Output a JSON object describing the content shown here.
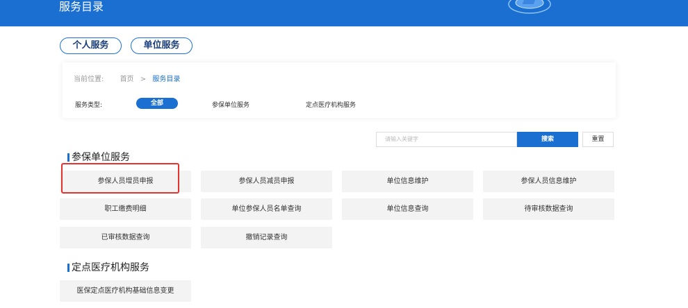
{
  "header": {
    "title": "服务目录"
  },
  "tabs": [
    {
      "label": "个人服务"
    },
    {
      "label": "单位服务"
    }
  ],
  "breadcrumb": {
    "label": "当前位置:",
    "home": "首页",
    "separator": ">",
    "current": "服务目录"
  },
  "filters": {
    "label": "服务类型:",
    "options": [
      "全部",
      "参保单位服务",
      "定点医疗机构服务"
    ],
    "selected": "全部"
  },
  "search": {
    "placeholder": "请输入关键字",
    "search_label": "搜索",
    "reset_label": "重置"
  },
  "sections": [
    {
      "title": "参保单位服务",
      "items": [
        "参保人员增员申报",
        "参保人员减员申报",
        "单位信息维护",
        "参保人员信息维护",
        "职工缴费明细",
        "单位参保人员名单查询",
        "单位信息查询",
        "待审核数据查询",
        "已审核数据查询",
        "撤销记录查询"
      ]
    },
    {
      "title": "定点医疗机构服务",
      "items": [
        "医保定点医疗机构基础信息变更"
      ]
    }
  ],
  "colors": {
    "primary": "#1a6fd0",
    "highlight": "#e5322d",
    "tile": "#f3f3f3"
  }
}
